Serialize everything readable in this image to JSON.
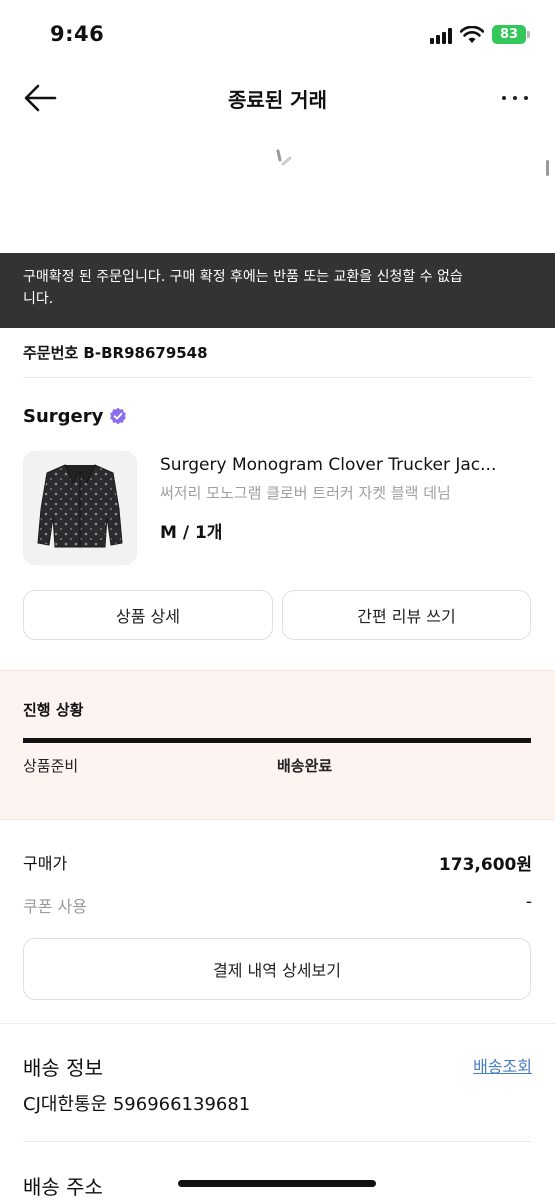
{
  "status_bar": {
    "time": "9:46",
    "battery": "83"
  },
  "nav": {
    "title": "종료된 거래"
  },
  "notice": {
    "text": "구매확정 된 주문입니다. 구매 확정 후에는 반품 또는 교환을 신청할 수 없습니다."
  },
  "order": {
    "number_label": "주문번호 B-BR98679548"
  },
  "seller": {
    "name": "Surgery"
  },
  "product": {
    "name": "Surgery Monogram Clover Trucker Jac...",
    "name_ko": "써저리 모노그램 클로버 트러커 자켓 블랙 데님",
    "option": "M / 1개"
  },
  "buttons": {
    "detail": "상품 상세",
    "review": "간편 리뷰 쓰기"
  },
  "progress": {
    "title": "진행 상황",
    "level": 1.0,
    "steps": [
      "상품준비",
      "배송완료"
    ]
  },
  "payment": {
    "price_label": "구매가",
    "price_value": "173,600원",
    "coupon_label": "쿠폰 사용",
    "coupon_value": "-",
    "details_button": "결제 내역 상세보기"
  },
  "shipping": {
    "title": "배송 정보",
    "track_link": "배송조회",
    "carrier": "CJ대한통운 596966139681"
  },
  "address": {
    "title": "배송 주소"
  },
  "colors": {
    "banner": "#333333",
    "progress_bg": "#fdf4f1",
    "verified": "#8b6cf0",
    "battery": "#34c759",
    "link": "#4a7fc1"
  }
}
